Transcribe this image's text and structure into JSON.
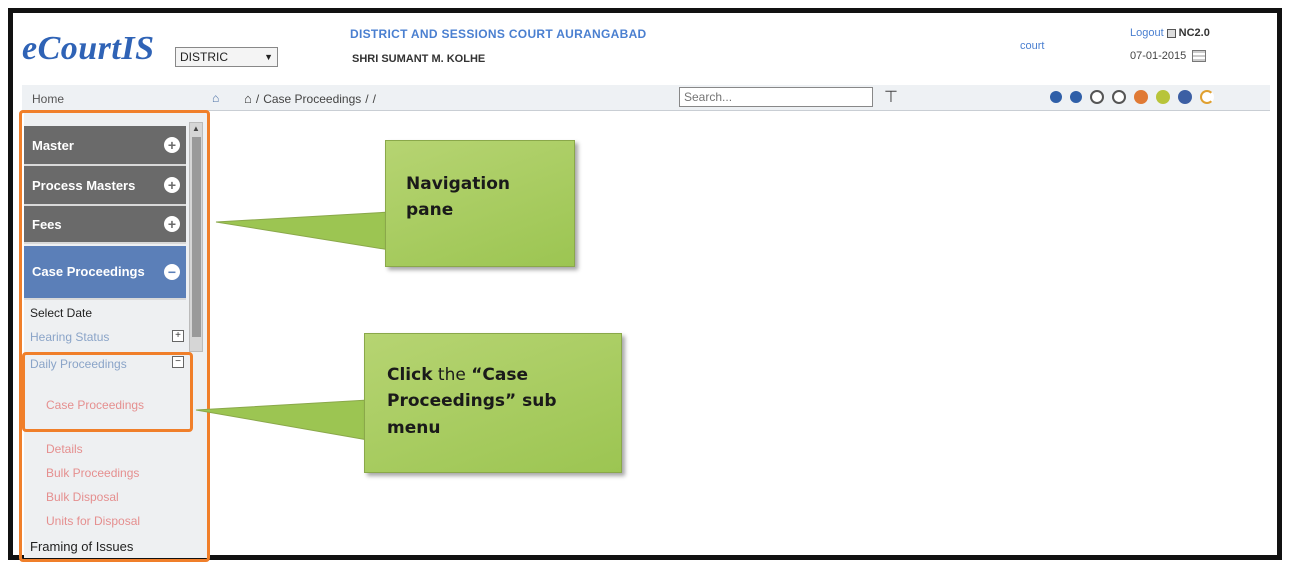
{
  "header": {
    "logo": "eCourtIS",
    "establishment_select": "DISTRIC",
    "court_name": "DISTRICT AND SESSIONS COURT AURANGABAD",
    "judge_name": "SHRI SUMANT M. KOLHE",
    "court_link": "court",
    "logout": "Logout",
    "version": "NC2.0",
    "date": "07-01-2015"
  },
  "topbar": {
    "home": "Home",
    "breadcrumb": [
      "Case Proceedings",
      "/",
      "/"
    ],
    "search_placeholder": "Search..."
  },
  "sidebar": {
    "menus": [
      {
        "label": "Master"
      },
      {
        "label": "Process Masters"
      },
      {
        "label": "Fees"
      },
      {
        "label": "Case Proceedings"
      }
    ],
    "submenu": {
      "select_date": "Select Date",
      "hearing_status": "Hearing Status",
      "daily_proceedings": "Daily Proceedings",
      "case_proceedings": "Case Proceedings",
      "details": "Details",
      "bulk_proceedings": "Bulk Proceedings",
      "bulk_disposal": "Bulk Disposal",
      "units_for_disposal": "Units for Disposal",
      "framing_of_issues": "Framing of Issues"
    }
  },
  "callouts": {
    "navigation": {
      "line1": "Navigation",
      "line2": "pane"
    },
    "click": {
      "word1": "Click",
      "word2": "the",
      "line1_rest": "“Case",
      "line2": "Proceedings” sub",
      "line3": "menu"
    }
  },
  "colors": {
    "highlight": "#f07f2a",
    "callout": "#a8cc5e",
    "menu_active": "#5b7fb8",
    "menu_default": "#6a6a6a"
  }
}
